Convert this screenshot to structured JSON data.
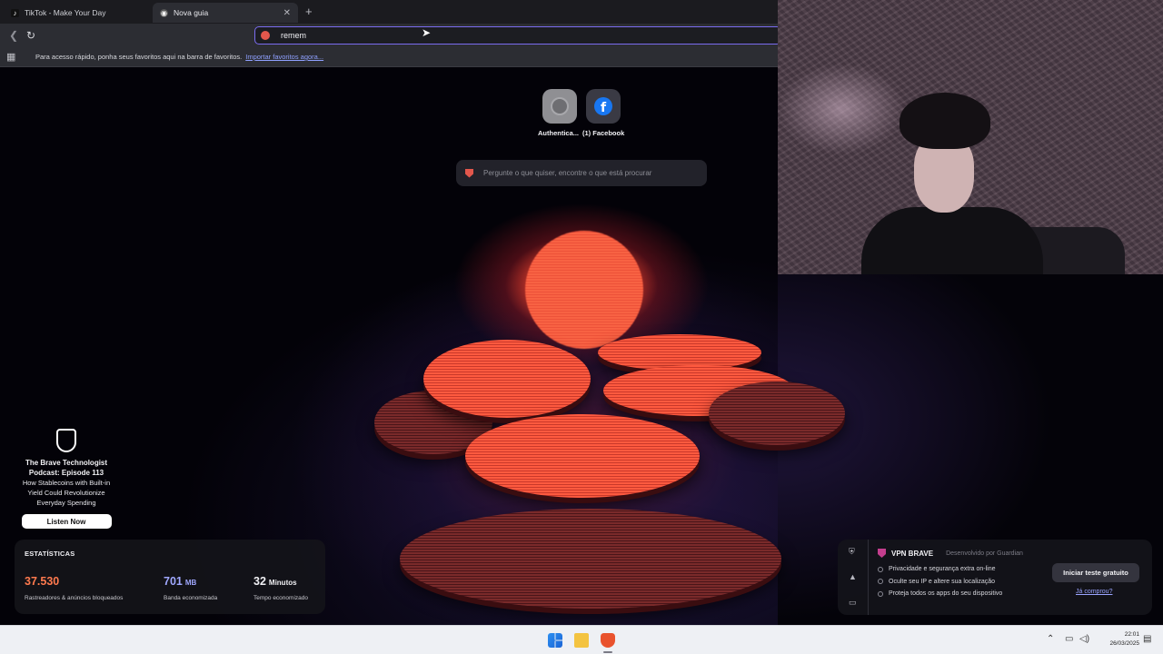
{
  "browser": {
    "tabs": [
      {
        "label": "TikTok - Make Your Day",
        "icon": "tiktok-icon"
      },
      {
        "label": "Nova guia",
        "icon": "brave-shield-icon",
        "active": true
      }
    ],
    "address_value": "remem",
    "bookmarks_message": "Para acesso rápido, ponha seus favoritos aqui na barra de favoritos.",
    "bookmarks_import_link": "Importar favoritos agora..."
  },
  "new_tab": {
    "top_sites": [
      {
        "label": "Authentica...",
        "icon": "globe-icon"
      },
      {
        "label": "(1) Facebook",
        "icon": "facebook-icon"
      }
    ],
    "ask_placeholder": "Pergunte o que quiser, encontre o que está procurar",
    "podcast": {
      "title": "The Brave Technologist Podcast: Episode 113",
      "description": "How Stablecoins with Built-in Yield Could Revolutionize Everyday Spending",
      "button": "Listen Now"
    },
    "stats": {
      "heading": "ESTATÍSTICAS",
      "items": [
        {
          "value": "37.530",
          "unit": "",
          "label": "Rastreadores & anúncios bloqueados",
          "color": "#ff7a4e"
        },
        {
          "value": "701",
          "unit": "MB",
          "label": "Banda economizada",
          "color": "#a0a8ff"
        },
        {
          "value": "32",
          "unit": "Minutos",
          "label": "Tempo economizado",
          "color": "#f0f0f4"
        }
      ]
    },
    "vpn": {
      "title": "VPN BRAVE",
      "by": "Desenvolvido por Guardian",
      "features": [
        "Privacidade e segurança extra on-line",
        "Oculte seu IP e altere sua localização",
        "Proteja todos os apps do seu dispositivo"
      ],
      "cta": "Iniciar teste gratuito",
      "already_bought": "Já comprou?"
    }
  },
  "taskbar": {
    "time": "22:01",
    "date": "26/03/2025",
    "icons": [
      "windows-start-icon",
      "file-explorer-icon",
      "brave-browser-icon"
    ]
  },
  "colors": {
    "accent": "#7a6cf0",
    "brave_orange": "#e9522d"
  }
}
